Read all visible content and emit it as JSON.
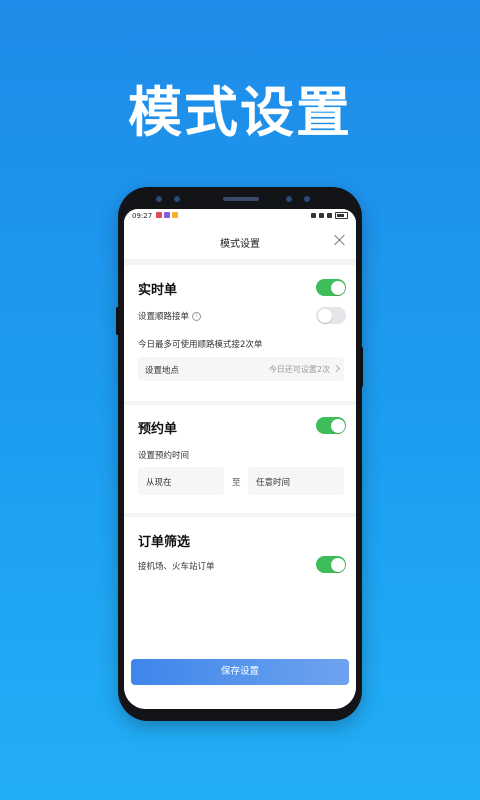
{
  "hero": {
    "title": "模式设置"
  },
  "status_bar": {
    "time": "09:27"
  },
  "dialog": {
    "title": "模式设置",
    "realtime": {
      "title": "实时单",
      "enabled": true,
      "route_label": "设置顺路接单",
      "route_enabled": false,
      "limit_text": "今日最多可使用顺路模式接2次单",
      "location_label": "设置地点",
      "location_value": "今日还可设置2次"
    },
    "reservation": {
      "title": "预约单",
      "enabled": true,
      "time_label": "设置预约时间",
      "from": "从现在",
      "to_separator": "至",
      "to": "任意时间"
    },
    "filter": {
      "title": "订单筛选",
      "airport_label": "接机场、火车站订单",
      "airport_enabled": true
    },
    "save_label": "保存设置"
  },
  "colors": {
    "toggle_on": "#3ebd5a",
    "toggle_off": "#e3e5e8",
    "accent": "#3d86ea"
  }
}
